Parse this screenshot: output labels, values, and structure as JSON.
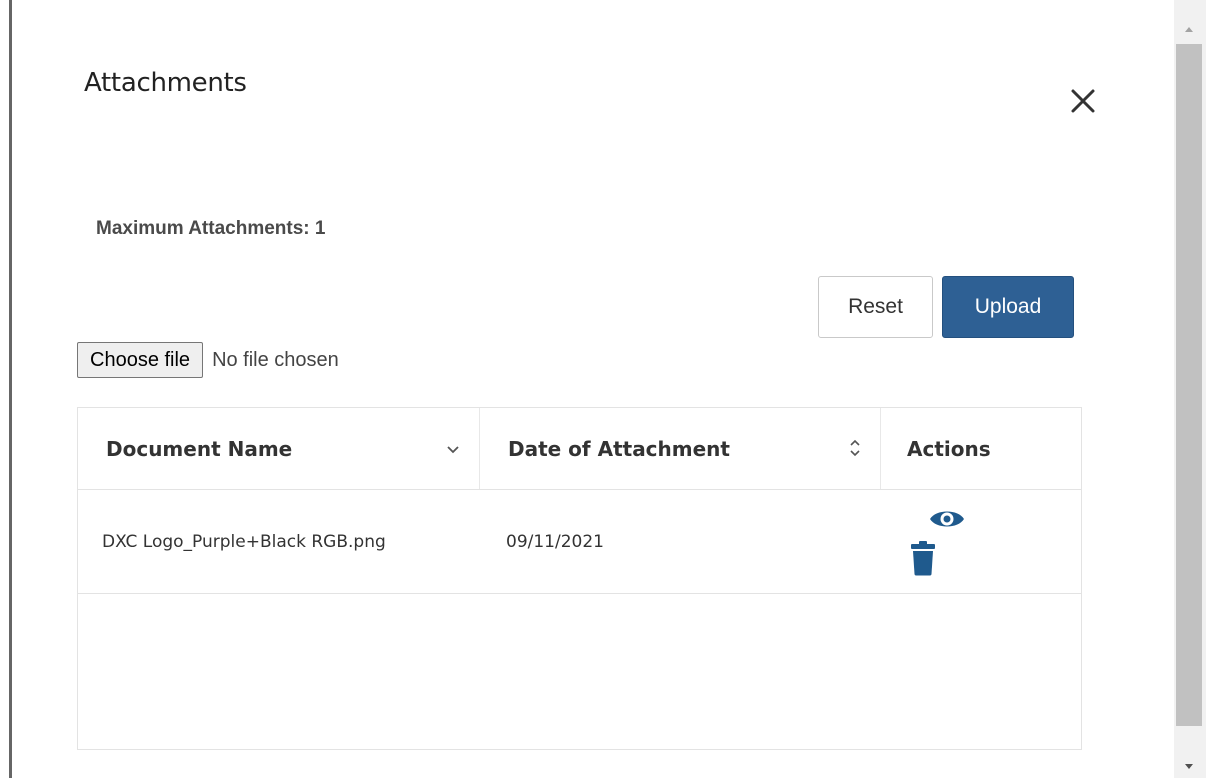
{
  "dialog": {
    "title": "Attachments",
    "max_label": "Maximum Attachments: 1",
    "buttons": {
      "reset": "Reset",
      "upload": "Upload"
    },
    "file_input": {
      "button_label": "Choose file",
      "status": "No file chosen"
    }
  },
  "table": {
    "columns": [
      {
        "label": "Document Name",
        "sort_icon": "chevron-down-icon"
      },
      {
        "label": "Date of Attachment",
        "sort_icon": "sort-updown-icon"
      },
      {
        "label": "Actions"
      }
    ],
    "rows": [
      {
        "document_name": "DXC Logo_Purple+Black RGB.png",
        "date": "09/11/2021",
        "actions": [
          "eye-icon",
          "trash-icon"
        ]
      }
    ]
  },
  "colors": {
    "primary": "#2e6094",
    "icon_blue": "#1f5a8d",
    "text": "#333333",
    "border": "#e3e3e3"
  }
}
